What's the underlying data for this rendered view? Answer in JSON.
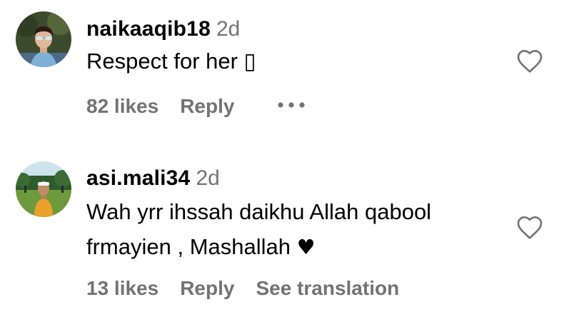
{
  "comments": [
    {
      "username": "naikaaqib18",
      "time": "2d",
      "text": "Respect for her ▯",
      "likes": "82 likes",
      "reply": "Reply",
      "more_icon": "more-horizontal-icon",
      "like_icon": "heart-outline-icon"
    },
    {
      "username": "asi.mali34",
      "time": "2d",
      "text_line1": "Wah yrr ihssah daikhu Allah qabool",
      "text_line2": "frmayien , Mashallah",
      "heart": "♥",
      "likes": "13 likes",
      "reply": "Reply",
      "see_translation": "See translation",
      "like_icon": "heart-outline-icon"
    }
  ],
  "colors": {
    "text": "#000000",
    "secondary": "#737373",
    "background": "#ffffff"
  }
}
